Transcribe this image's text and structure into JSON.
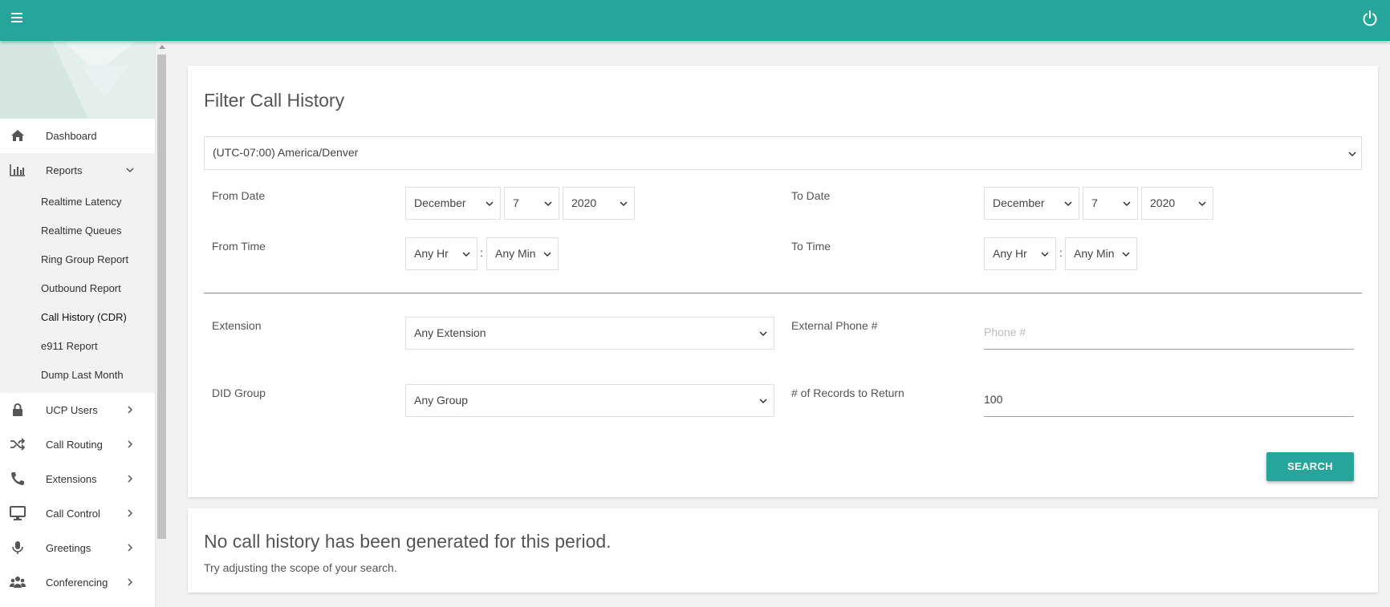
{
  "header": {
    "menu_icon": "hamburger-icon",
    "power_icon": "power-icon",
    "accent": "#26a69a"
  },
  "sidebar": {
    "items": [
      {
        "label": "Dashboard",
        "icon": "home-icon"
      },
      {
        "label": "Reports",
        "icon": "bar-chart-icon",
        "expanded": true,
        "children": [
          "Realtime Latency",
          "Realtime Queues",
          "Ring Group Report",
          "Outbound Report",
          "Call History (CDR)",
          "e911 Report",
          "Dump Last Month"
        ]
      },
      {
        "label": "UCP Users",
        "icon": "lock-icon"
      },
      {
        "label": "Call Routing",
        "icon": "shuffle-icon"
      },
      {
        "label": "Extensions",
        "icon": "phone-icon"
      },
      {
        "label": "Call Control",
        "icon": "monitor-icon"
      },
      {
        "label": "Greetings",
        "icon": "microphone-icon"
      },
      {
        "label": "Conferencing",
        "icon": "users-icon"
      }
    ],
    "active_child": "Call History (CDR)"
  },
  "filter": {
    "title": "Filter Call History",
    "timezone": "(UTC-07:00) America/Denver",
    "from_date_label": "From Date",
    "from_date": {
      "month": "December",
      "day": "7",
      "year": "2020"
    },
    "to_date_label": "To Date",
    "to_date": {
      "month": "December",
      "day": "7",
      "year": "2020"
    },
    "from_time_label": "From Time",
    "from_time": {
      "hour": "Any Hr",
      "minute": "Any Min"
    },
    "to_time_label": "To Time",
    "to_time": {
      "hour": "Any Hr",
      "minute": "Any Min"
    },
    "time_separator": ":",
    "extension_label": "Extension",
    "extension_value": "Any Extension",
    "external_phone_label": "External Phone #",
    "external_phone_placeholder": "Phone #",
    "did_group_label": "DID Group",
    "did_group_value": "Any Group",
    "records_label": "# of Records to Return",
    "records_value": "100",
    "search_label": "SEARCH"
  },
  "results": {
    "empty_title": "No call history has been generated for this period.",
    "empty_hint": "Try adjusting the scope of your search."
  }
}
